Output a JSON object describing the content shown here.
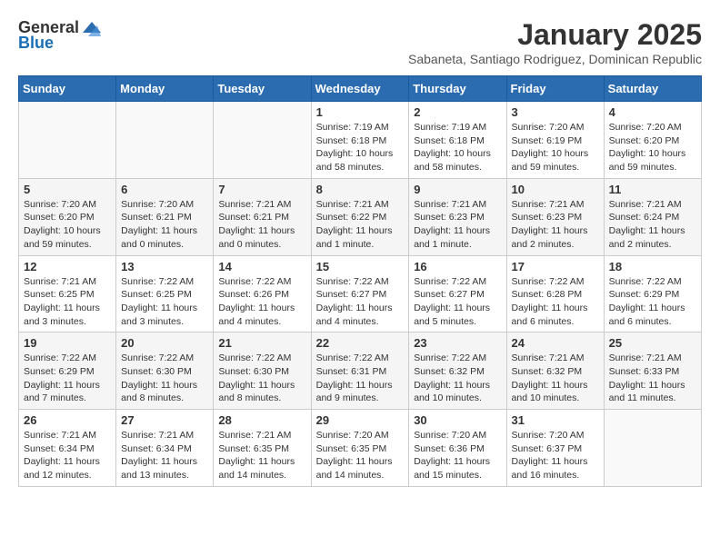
{
  "header": {
    "logo_general": "General",
    "logo_blue": "Blue",
    "month_title": "January 2025",
    "subtitle": "Sabaneta, Santiago Rodriguez, Dominican Republic"
  },
  "days_of_week": [
    "Sunday",
    "Monday",
    "Tuesday",
    "Wednesday",
    "Thursday",
    "Friday",
    "Saturday"
  ],
  "weeks": [
    [
      {
        "num": "",
        "info": ""
      },
      {
        "num": "",
        "info": ""
      },
      {
        "num": "",
        "info": ""
      },
      {
        "num": "1",
        "info": "Sunrise: 7:19 AM\nSunset: 6:18 PM\nDaylight: 10 hours\nand 58 minutes."
      },
      {
        "num": "2",
        "info": "Sunrise: 7:19 AM\nSunset: 6:18 PM\nDaylight: 10 hours\nand 58 minutes."
      },
      {
        "num": "3",
        "info": "Sunrise: 7:20 AM\nSunset: 6:19 PM\nDaylight: 10 hours\nand 59 minutes."
      },
      {
        "num": "4",
        "info": "Sunrise: 7:20 AM\nSunset: 6:20 PM\nDaylight: 10 hours\nand 59 minutes."
      }
    ],
    [
      {
        "num": "5",
        "info": "Sunrise: 7:20 AM\nSunset: 6:20 PM\nDaylight: 10 hours\nand 59 minutes."
      },
      {
        "num": "6",
        "info": "Sunrise: 7:20 AM\nSunset: 6:21 PM\nDaylight: 11 hours\nand 0 minutes."
      },
      {
        "num": "7",
        "info": "Sunrise: 7:21 AM\nSunset: 6:21 PM\nDaylight: 11 hours\nand 0 minutes."
      },
      {
        "num": "8",
        "info": "Sunrise: 7:21 AM\nSunset: 6:22 PM\nDaylight: 11 hours\nand 1 minute."
      },
      {
        "num": "9",
        "info": "Sunrise: 7:21 AM\nSunset: 6:23 PM\nDaylight: 11 hours\nand 1 minute."
      },
      {
        "num": "10",
        "info": "Sunrise: 7:21 AM\nSunset: 6:23 PM\nDaylight: 11 hours\nand 2 minutes."
      },
      {
        "num": "11",
        "info": "Sunrise: 7:21 AM\nSunset: 6:24 PM\nDaylight: 11 hours\nand 2 minutes."
      }
    ],
    [
      {
        "num": "12",
        "info": "Sunrise: 7:21 AM\nSunset: 6:25 PM\nDaylight: 11 hours\nand 3 minutes."
      },
      {
        "num": "13",
        "info": "Sunrise: 7:22 AM\nSunset: 6:25 PM\nDaylight: 11 hours\nand 3 minutes."
      },
      {
        "num": "14",
        "info": "Sunrise: 7:22 AM\nSunset: 6:26 PM\nDaylight: 11 hours\nand 4 minutes."
      },
      {
        "num": "15",
        "info": "Sunrise: 7:22 AM\nSunset: 6:27 PM\nDaylight: 11 hours\nand 4 minutes."
      },
      {
        "num": "16",
        "info": "Sunrise: 7:22 AM\nSunset: 6:27 PM\nDaylight: 11 hours\nand 5 minutes."
      },
      {
        "num": "17",
        "info": "Sunrise: 7:22 AM\nSunset: 6:28 PM\nDaylight: 11 hours\nand 6 minutes."
      },
      {
        "num": "18",
        "info": "Sunrise: 7:22 AM\nSunset: 6:29 PM\nDaylight: 11 hours\nand 6 minutes."
      }
    ],
    [
      {
        "num": "19",
        "info": "Sunrise: 7:22 AM\nSunset: 6:29 PM\nDaylight: 11 hours\nand 7 minutes."
      },
      {
        "num": "20",
        "info": "Sunrise: 7:22 AM\nSunset: 6:30 PM\nDaylight: 11 hours\nand 8 minutes."
      },
      {
        "num": "21",
        "info": "Sunrise: 7:22 AM\nSunset: 6:30 PM\nDaylight: 11 hours\nand 8 minutes."
      },
      {
        "num": "22",
        "info": "Sunrise: 7:22 AM\nSunset: 6:31 PM\nDaylight: 11 hours\nand 9 minutes."
      },
      {
        "num": "23",
        "info": "Sunrise: 7:22 AM\nSunset: 6:32 PM\nDaylight: 11 hours\nand 10 minutes."
      },
      {
        "num": "24",
        "info": "Sunrise: 7:21 AM\nSunset: 6:32 PM\nDaylight: 11 hours\nand 10 minutes."
      },
      {
        "num": "25",
        "info": "Sunrise: 7:21 AM\nSunset: 6:33 PM\nDaylight: 11 hours\nand 11 minutes."
      }
    ],
    [
      {
        "num": "26",
        "info": "Sunrise: 7:21 AM\nSunset: 6:34 PM\nDaylight: 11 hours\nand 12 minutes."
      },
      {
        "num": "27",
        "info": "Sunrise: 7:21 AM\nSunset: 6:34 PM\nDaylight: 11 hours\nand 13 minutes."
      },
      {
        "num": "28",
        "info": "Sunrise: 7:21 AM\nSunset: 6:35 PM\nDaylight: 11 hours\nand 14 minutes."
      },
      {
        "num": "29",
        "info": "Sunrise: 7:20 AM\nSunset: 6:35 PM\nDaylight: 11 hours\nand 14 minutes."
      },
      {
        "num": "30",
        "info": "Sunrise: 7:20 AM\nSunset: 6:36 PM\nDaylight: 11 hours\nand 15 minutes."
      },
      {
        "num": "31",
        "info": "Sunrise: 7:20 AM\nSunset: 6:37 PM\nDaylight: 11 hours\nand 16 minutes."
      },
      {
        "num": "",
        "info": ""
      }
    ]
  ]
}
